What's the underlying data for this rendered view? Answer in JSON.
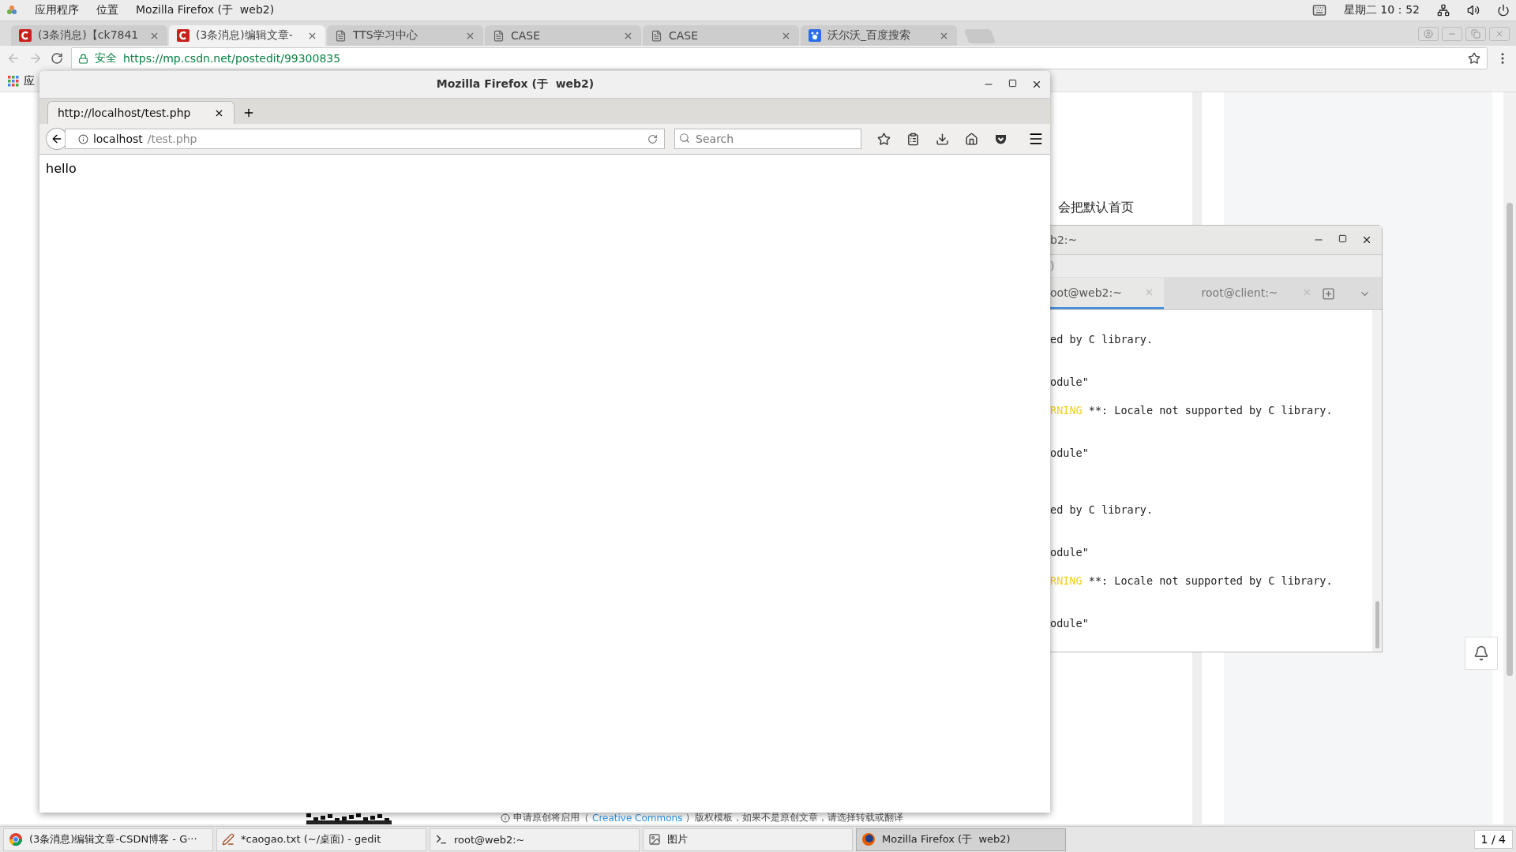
{
  "top_bar": {
    "menus": [
      "应用程序",
      "位置",
      "Mozilla Firefox (于  web2)"
    ],
    "clock": "星期二 10：52"
  },
  "chrome": {
    "tabs": [
      {
        "label": "(3条消息)【ck7841",
        "kind": "csdn",
        "selected": false
      },
      {
        "label": "(3条消息)编辑文章-",
        "kind": "csdn",
        "selected": true
      },
      {
        "label": "TTS学习中心",
        "kind": "doc",
        "selected": false
      },
      {
        "label": "CASE",
        "kind": "doc",
        "selected": false
      },
      {
        "label": "CASE",
        "kind": "doc",
        "selected": false
      },
      {
        "label": "沃尔沃_百度搜索",
        "kind": "baidu",
        "selected": false
      }
    ],
    "secure_label": "安全",
    "url": "https://mp.csdn.net/postedit/99300835",
    "bookmark": "应",
    "page_heading": "会把默认首页",
    "notice_before": "申请原创将启用（",
    "notice_link": "Creative Commons",
    "notice_after": "）版权模板，如果不是原创文章，请选择转载或翻译"
  },
  "firefox": {
    "title": "Mozilla Firefox (于  web2)",
    "tab": "http://localhost/test.php",
    "url_host": "localhost",
    "url_path": "/test.php",
    "search": {
      "placeholder": "Search"
    },
    "content": "hello"
  },
  "terminal": {
    "title": "b2:~",
    "menu": ")",
    "tabs": [
      {
        "label": "oot@web2:~",
        "selected": true
      },
      {
        "label": "root@client:~",
        "selected": false
      }
    ],
    "lines": [
      {
        "kind": "plain",
        "text": "ed by C library."
      },
      {
        "kind": "blank"
      },
      {
        "kind": "blank"
      },
      {
        "kind": "plain",
        "text": "odule\""
      },
      {
        "kind": "blank"
      },
      {
        "kind": "warning",
        "tag": "RNING",
        "text": " **: Locale not supported by C library."
      },
      {
        "kind": "blank"
      },
      {
        "kind": "blank"
      },
      {
        "kind": "plain",
        "text": "odule\""
      },
      {
        "kind": "blank"
      },
      {
        "kind": "blank"
      },
      {
        "kind": "blank"
      },
      {
        "kind": "plain",
        "text": "ed by C library."
      },
      {
        "kind": "blank"
      },
      {
        "kind": "blank"
      },
      {
        "kind": "plain",
        "text": "odule\""
      },
      {
        "kind": "blank"
      },
      {
        "kind": "warning",
        "tag": "RNING",
        "text": " **: Locale not supported by C library."
      },
      {
        "kind": "blank"
      },
      {
        "kind": "blank"
      },
      {
        "kind": "plain",
        "text": "odule\""
      }
    ]
  },
  "taskbar": {
    "items": [
      {
        "label": "(3条消息)编辑文章-CSDN博客 - G···",
        "kind": "chrome",
        "selected": false
      },
      {
        "label": "*caogao.txt (~/桌面) - gedit",
        "kind": "editor",
        "selected": false
      },
      {
        "label": "root@web2:~",
        "kind": "terminal",
        "selected": false
      },
      {
        "label": "图片",
        "kind": "viewer",
        "selected": false
      },
      {
        "label": "Mozilla Firefox (于  web2)",
        "kind": "firefox",
        "selected": true
      }
    ],
    "workspace": "1 / 4"
  }
}
